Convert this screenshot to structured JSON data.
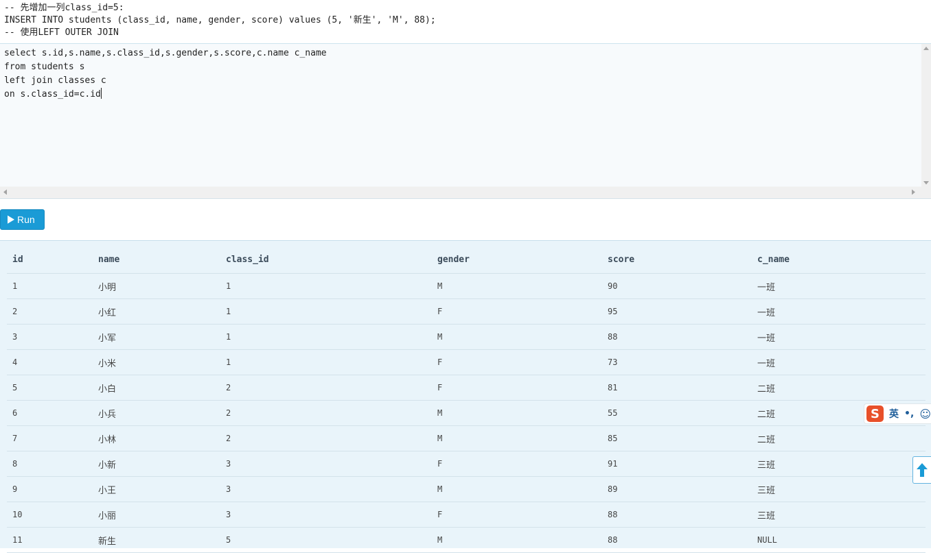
{
  "top_code": {
    "lines": [
      "-- 先增加一列class_id=5:",
      "INSERT INTO students (class_id, name, gender, score) values (5, '新生', 'M', 88);",
      "-- 使用LEFT OUTER JOIN"
    ]
  },
  "editor": {
    "lines": [
      "select s.id,s.name,s.class_id,s.gender,s.score,c.name c_name",
      "from students s",
      "left join classes c",
      "on s.class_id=c.id"
    ]
  },
  "run_button": {
    "label": "Run",
    "icon": "play-icon"
  },
  "results": {
    "columns": [
      "id",
      "name",
      "class_id",
      "gender",
      "score",
      "c_name"
    ],
    "rows": [
      [
        "1",
        "小明",
        "1",
        "M",
        "90",
        "一班"
      ],
      [
        "2",
        "小红",
        "1",
        "F",
        "95",
        "一班"
      ],
      [
        "3",
        "小军",
        "1",
        "M",
        "88",
        "一班"
      ],
      [
        "4",
        "小米",
        "1",
        "F",
        "73",
        "一班"
      ],
      [
        "5",
        "小白",
        "2",
        "F",
        "81",
        "二班"
      ],
      [
        "6",
        "小兵",
        "2",
        "M",
        "55",
        "二班"
      ],
      [
        "7",
        "小林",
        "2",
        "M",
        "85",
        "二班"
      ],
      [
        "8",
        "小新",
        "3",
        "F",
        "91",
        "三班"
      ],
      [
        "9",
        "小王",
        "3",
        "M",
        "89",
        "三班"
      ],
      [
        "10",
        "小丽",
        "3",
        "F",
        "88",
        "三班"
      ],
      [
        "11",
        "新生",
        "5",
        "M",
        "88",
        "NULL"
      ]
    ]
  },
  "ime": {
    "logo": "S",
    "lang": "英",
    "punct": "•,",
    "icon": "smile-icon"
  },
  "back_to_top": {
    "icon": "arrow-up-icon"
  },
  "colors": {
    "accent": "#1a9bd6",
    "results_bg": "#e9f4fa",
    "ime_logo": "#e8502a"
  }
}
